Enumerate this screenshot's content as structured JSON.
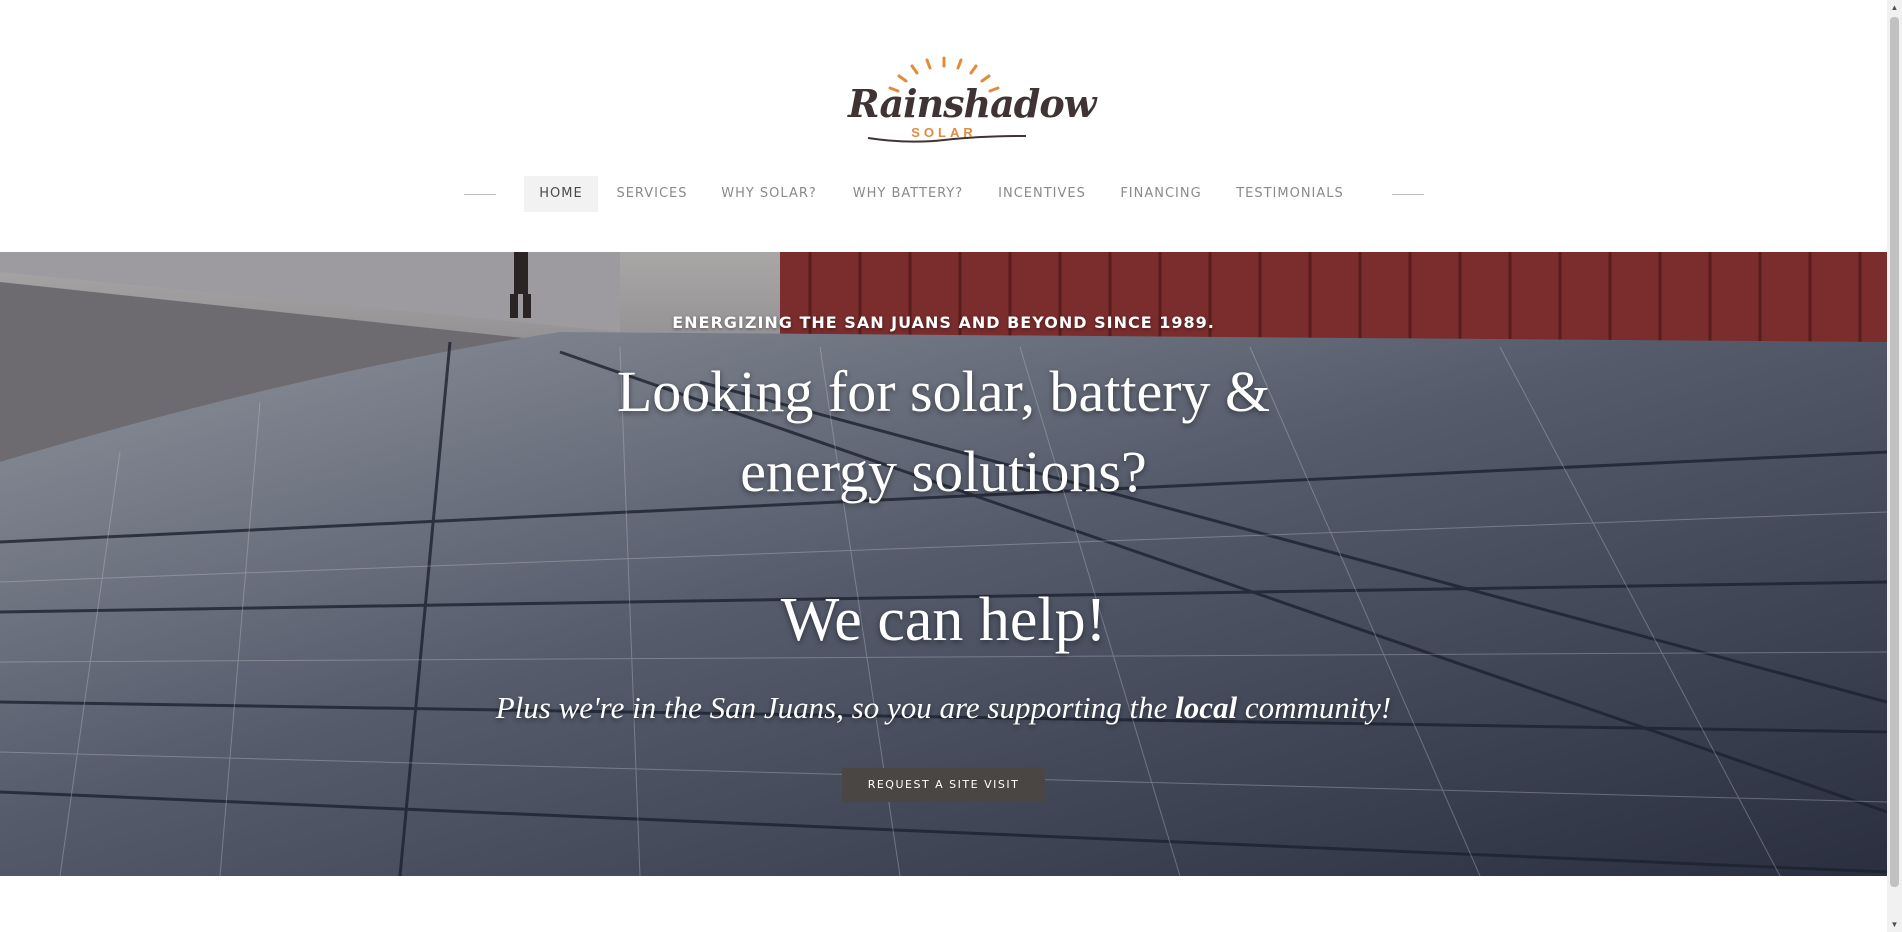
{
  "brand": {
    "logo_word": "Rainshadow",
    "logo_sub": "SOLAR",
    "icon": "sunburst-icon",
    "colors": {
      "logo_text": "#3f3433",
      "logo_accent": "#e38b3c"
    }
  },
  "nav": {
    "items": [
      {
        "label": "HOME",
        "active": true
      },
      {
        "label": "SERVICES"
      },
      {
        "label": "WHY SOLAR?"
      },
      {
        "label": "WHY BATTERY?"
      },
      {
        "label": "INCENTIVES"
      },
      {
        "label": "FINANCING"
      },
      {
        "label": "TESTIMONIALS"
      }
    ]
  },
  "hero": {
    "eyebrow": "ENERGIZING THE SAN JUANS AND BEYOND SINCE 1989.",
    "headline_line1": "Looking for solar, battery &",
    "headline_line2": "energy solutions?",
    "help": "We can help!",
    "sub_before": "Plus we're in the San Juans, so you are supporting the ",
    "sub_bold": "local",
    "sub_after": " community!",
    "cta": "REQUEST A SITE VISIT",
    "background": "rooftop-solar-panels-photo",
    "colors": {
      "cta_bg": "#4a4644",
      "text": "#ffffff"
    }
  },
  "scrollbar": {
    "icon_up": "scroll-up-arrow-icon",
    "icon_down": "scroll-down-arrow-icon"
  }
}
